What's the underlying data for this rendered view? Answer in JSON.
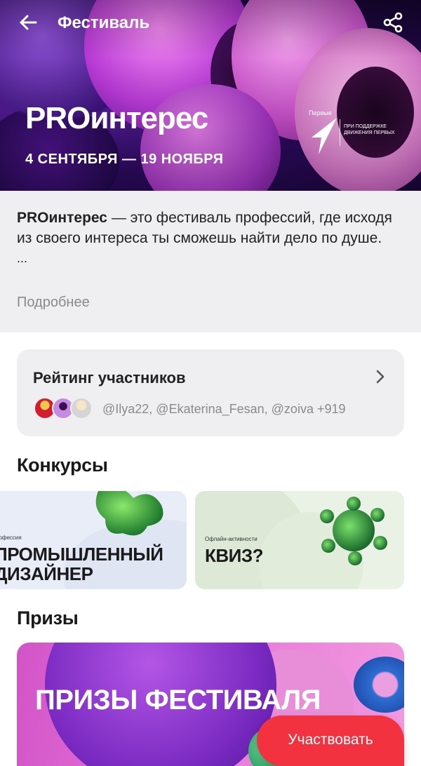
{
  "topbar": {
    "title": "Фестиваль",
    "back_icon": "arrow-left-icon",
    "share_icon": "share-icon"
  },
  "hero": {
    "title": "PROинтерес",
    "dates": "4 СЕНТЯБРЯ — 19 НОЯБРЯ",
    "brand_name": "Первые",
    "brand_sub": "При поддержке Движения Первых"
  },
  "description": {
    "name": "PROинтерес",
    "text": " — это фестиваль профессий, где исходя из своего интереса ты сможешь найти дело по душе.",
    "ellipsis": "...",
    "more_label": "Подробнее"
  },
  "rating": {
    "title": "Рейтинг участников",
    "users": "@Ilya22, @Ekaterina_Fesan, @zoiva +919",
    "chevron_icon": "chevron-right-icon"
  },
  "contests": {
    "title": "Конкурсы",
    "items": [
      {
        "tag": "рофессия",
        "name": "ПРОМЫШЛЕННЫЙ ДИЗАЙНЕР"
      },
      {
        "tag": "Офлайн-активности",
        "name": "КВИЗ?"
      }
    ]
  },
  "prizes": {
    "title": "Призы",
    "card_text": "Призы фестиваля"
  },
  "cta": {
    "label": "Участвовать"
  },
  "colors": {
    "accent": "#f2323f",
    "card_bg": "#efeff1"
  }
}
